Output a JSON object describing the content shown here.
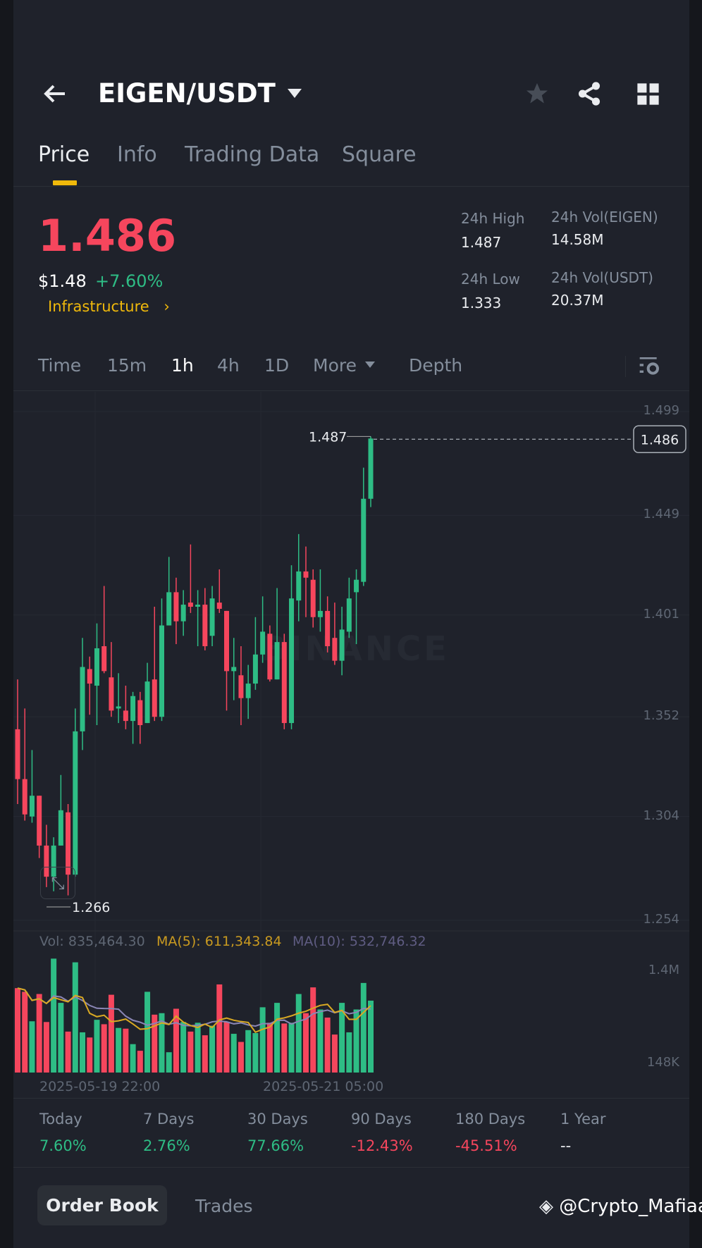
{
  "header": {
    "title": "EIGEN/USDT"
  },
  "tabs": [
    {
      "label": "Price"
    },
    {
      "label": "Info"
    },
    {
      "label": "Trading Data"
    },
    {
      "label": "Square"
    }
  ],
  "ticker": {
    "last_price": "1.486",
    "usd_price": "$1.48",
    "change": "+7.60%",
    "category": "Infrastructure",
    "high_label": "24h High",
    "high": "1.487",
    "low_label": "24h Low",
    "low": "1.333",
    "vol_base_label": "24h Vol(EIGEN)",
    "vol_base": "14.58M",
    "vol_quote_label": "24h Vol(USDT)",
    "vol_quote": "20.37M"
  },
  "timeframes": {
    "time": "Time",
    "m15": "15m",
    "h1": "1h",
    "h4": "4h",
    "d1": "1D",
    "more": "More",
    "depth": "Depth",
    "active": "1h"
  },
  "colors": {
    "up": "#2ebd85",
    "down": "#f6465d",
    "accent": "#f0b90b",
    "ma5": "#d9a923",
    "ma10": "#8a86b5"
  },
  "chart_data": {
    "type": "candlestick",
    "price_axis_labels": [
      "1.499",
      "1.449",
      "1.401",
      "1.352",
      "1.304",
      "1.254"
    ],
    "price_ticks": [
      1.499,
      1.449,
      1.401,
      1.352,
      1.304,
      1.254
    ],
    "high_marker": "1.487",
    "low_marker": "1.266",
    "current_price": "1.486",
    "watermark": "BINANCE",
    "ohlc": [
      [
        1.346,
        1.37,
        1.31,
        1.322
      ],
      [
        1.322,
        1.356,
        1.302,
        1.305
      ],
      [
        1.304,
        1.336,
        1.301,
        1.314
      ],
      [
        1.314,
        1.314,
        1.284,
        1.29
      ],
      [
        1.29,
        1.3,
        1.27,
        1.275
      ],
      [
        1.275,
        1.294,
        1.268,
        1.29
      ],
      [
        1.29,
        1.324,
        1.29,
        1.307
      ],
      [
        1.306,
        1.31,
        1.266,
        1.276
      ],
      [
        1.276,
        1.356,
        1.275,
        1.345
      ],
      [
        1.345,
        1.39,
        1.336,
        1.376
      ],
      [
        1.375,
        1.381,
        1.353,
        1.368
      ],
      [
        1.367,
        1.397,
        1.348,
        1.385
      ],
      [
        1.386,
        1.415,
        1.373,
        1.374
      ],
      [
        1.371,
        1.388,
        1.352,
        1.355
      ],
      [
        1.356,
        1.373,
        1.349,
        1.357
      ],
      [
        1.355,
        1.367,
        1.346,
        1.35
      ],
      [
        1.35,
        1.364,
        1.339,
        1.362
      ],
      [
        1.36,
        1.364,
        1.339,
        1.348
      ],
      [
        1.349,
        1.378,
        1.349,
        1.369
      ],
      [
        1.37,
        1.405,
        1.35,
        1.352
      ],
      [
        1.352,
        1.409,
        1.35,
        1.396
      ],
      [
        1.396,
        1.429,
        1.396,
        1.412
      ],
      [
        1.412,
        1.419,
        1.387,
        1.398
      ],
      [
        1.398,
        1.413,
        1.391,
        1.406
      ],
      [
        1.407,
        1.435,
        1.402,
        1.405
      ],
      [
        1.405,
        1.413,
        1.386,
        1.406
      ],
      [
        1.406,
        1.414,
        1.384,
        1.386
      ],
      [
        1.391,
        1.415,
        1.386,
        1.409
      ],
      [
        1.407,
        1.423,
        1.402,
        1.404
      ],
      [
        1.403,
        1.403,
        1.355,
        1.374
      ],
      [
        1.374,
        1.39,
        1.36,
        1.376
      ],
      [
        1.372,
        1.386,
        1.348,
        1.361
      ],
      [
        1.361,
        1.377,
        1.351,
        1.368
      ],
      [
        1.368,
        1.4,
        1.365,
        1.382
      ],
      [
        1.382,
        1.41,
        1.378,
        1.393
      ],
      [
        1.392,
        1.396,
        1.369,
        1.37
      ],
      [
        1.37,
        1.414,
        1.37,
        1.388
      ],
      [
        1.388,
        1.392,
        1.346,
        1.349
      ],
      [
        1.349,
        1.425,
        1.346,
        1.409
      ],
      [
        1.408,
        1.44,
        1.398,
        1.422
      ],
      [
        1.422,
        1.434,
        1.4,
        1.419
      ],
      [
        1.418,
        1.423,
        1.395,
        1.4
      ],
      [
        1.4,
        1.423,
        1.393,
        1.403
      ],
      [
        1.403,
        1.41,
        1.383,
        1.386
      ],
      [
        1.39,
        1.407,
        1.377,
        1.379
      ],
      [
        1.379,
        1.405,
        1.372,
        1.394
      ],
      [
        1.393,
        1.419,
        1.39,
        1.409
      ],
      [
        1.412,
        1.423,
        1.387,
        1.418
      ],
      [
        1.417,
        1.472,
        1.415,
        1.457
      ],
      [
        1.457,
        1.487,
        1.453,
        1.486
      ]
    ],
    "volume": [
      1150,
      1100,
      700,
      1070,
      690,
      1550,
      950,
      560,
      1500,
      550,
      480,
      720,
      660,
      1060,
      610,
      600,
      390,
      300,
      1100,
      790,
      810,
      280,
      870,
      690,
      560,
      680,
      510,
      640,
      1200,
      690,
      530,
      420,
      580,
      540,
      890,
      680,
      950,
      670,
      680,
      1070,
      810,
      1160,
      860,
      750,
      520,
      950,
      550,
      860,
      1220,
      980
    ],
    "volume_unit": "K",
    "volume_axis_labels": [
      "1.4M",
      "148K"
    ],
    "volume_ticks": [
      1400000,
      148000
    ],
    "vol_legend": {
      "vol": "Vol: 835,464.30",
      "ma5": "MA(5): 611,343.84",
      "ma10": "MA(10): 532,746.32"
    },
    "x_labels": [
      "2025-05-19 22:00",
      "2025-05-21 05:00"
    ]
  },
  "performance": [
    {
      "label": "Today",
      "value": "7.60%",
      "dir": "up"
    },
    {
      "label": "7 Days",
      "value": "2.76%",
      "dir": "up"
    },
    {
      "label": "30 Days",
      "value": "77.66%",
      "dir": "up"
    },
    {
      "label": "90 Days",
      "value": "-12.43%",
      "dir": "down"
    },
    {
      "label": "180 Days",
      "value": "-45.51%",
      "dir": "down"
    },
    {
      "label": "1 Year",
      "value": "--",
      "dir": "none"
    }
  ],
  "bottom_tabs": {
    "order_book": "Order Book",
    "trades": "Trades"
  },
  "watermark_user": "@Crypto_Mafiaa"
}
